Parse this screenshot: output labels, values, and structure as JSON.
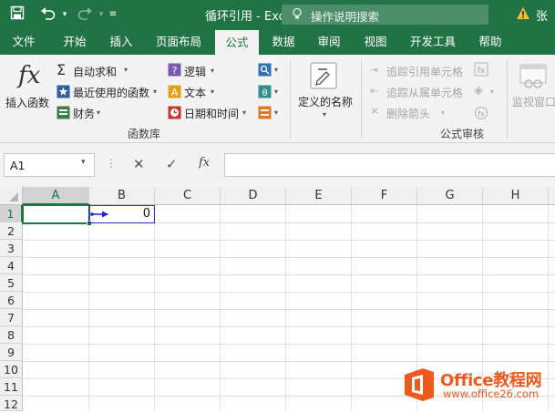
{
  "titlebar": {
    "title": "循环引用  -  Excel",
    "search_placeholder": "操作说明搜索",
    "user": "张",
    "warning_icon": "warning-icon"
  },
  "tabs": [
    "文件",
    "开始",
    "插入",
    "页面布局",
    "公式",
    "数据",
    "审阅",
    "视图",
    "开发工具",
    "帮助"
  ],
  "active_tab": "公式",
  "ribbon": {
    "insert_function": "插入函数",
    "autosum": "自动求和",
    "recent": "最近使用的函数",
    "financial": "财务",
    "logical": "逻辑",
    "text": "文本",
    "datetime": "日期和时间",
    "group_function_library": "函数库",
    "defined_names": "定义的名称",
    "trace_precedents": "追踪引用单元格",
    "trace_dependents": "追踪从属单元格",
    "remove_arrows": "删除箭头",
    "group_formula_auditing": "公式审核",
    "watch_window": "监视窗口"
  },
  "formula_bar": {
    "name_box": "A1",
    "formula": "",
    "fx": "fx"
  },
  "sheet": {
    "columns": [
      "A",
      "B",
      "C",
      "D",
      "E",
      "F",
      "G",
      "H"
    ],
    "rows": [
      "1",
      "2",
      "3",
      "4",
      "5",
      "6",
      "7",
      "8",
      "9",
      "10",
      "11",
      "12"
    ],
    "selected_cell": "A1",
    "b1_value": "0"
  },
  "watermark": {
    "brand": "Office教程网",
    "url": "www.office26.com"
  },
  "colors": {
    "excel_green": "#217346",
    "tracer_blue": "#1f1fd6",
    "watermark_orange": "#eb5a1e"
  }
}
